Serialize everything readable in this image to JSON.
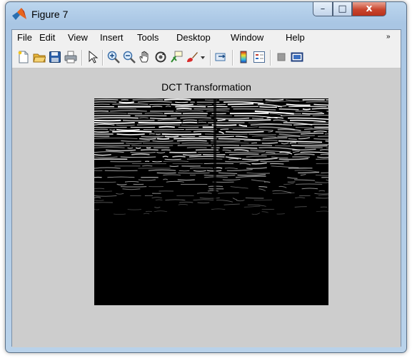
{
  "window": {
    "title": "Figure 7",
    "controls": {
      "minimize": "–",
      "maximize": "□",
      "close": "x"
    }
  },
  "menu": [
    "File",
    "Edit",
    "View",
    "Insert",
    "Tools",
    "Desktop",
    "Window",
    "Help"
  ],
  "menu_overflow": "»",
  "toolbar": {
    "icons": [
      "new-figure-icon",
      "open-file-icon",
      "save-figure-icon",
      "print-figure-icon",
      "edit-plot-icon",
      "zoom-in-icon",
      "zoom-out-icon",
      "pan-icon",
      "rotate-3d-icon",
      "data-cursor-icon",
      "brush-icon",
      "link-plot-icon",
      "colorbar-icon",
      "legend-icon",
      "hide-plot-tools-icon",
      "show-plot-tools-icon"
    ]
  },
  "axes": {
    "title": "DCT Transformation",
    "image": "dct-coefficient-image"
  },
  "colors": {
    "title_bar": "#a9c6e4",
    "figure_background": "#cdcdcd",
    "close_button": "#c9452d",
    "image_background": "#000000",
    "image_foreground": "#ffffff"
  }
}
